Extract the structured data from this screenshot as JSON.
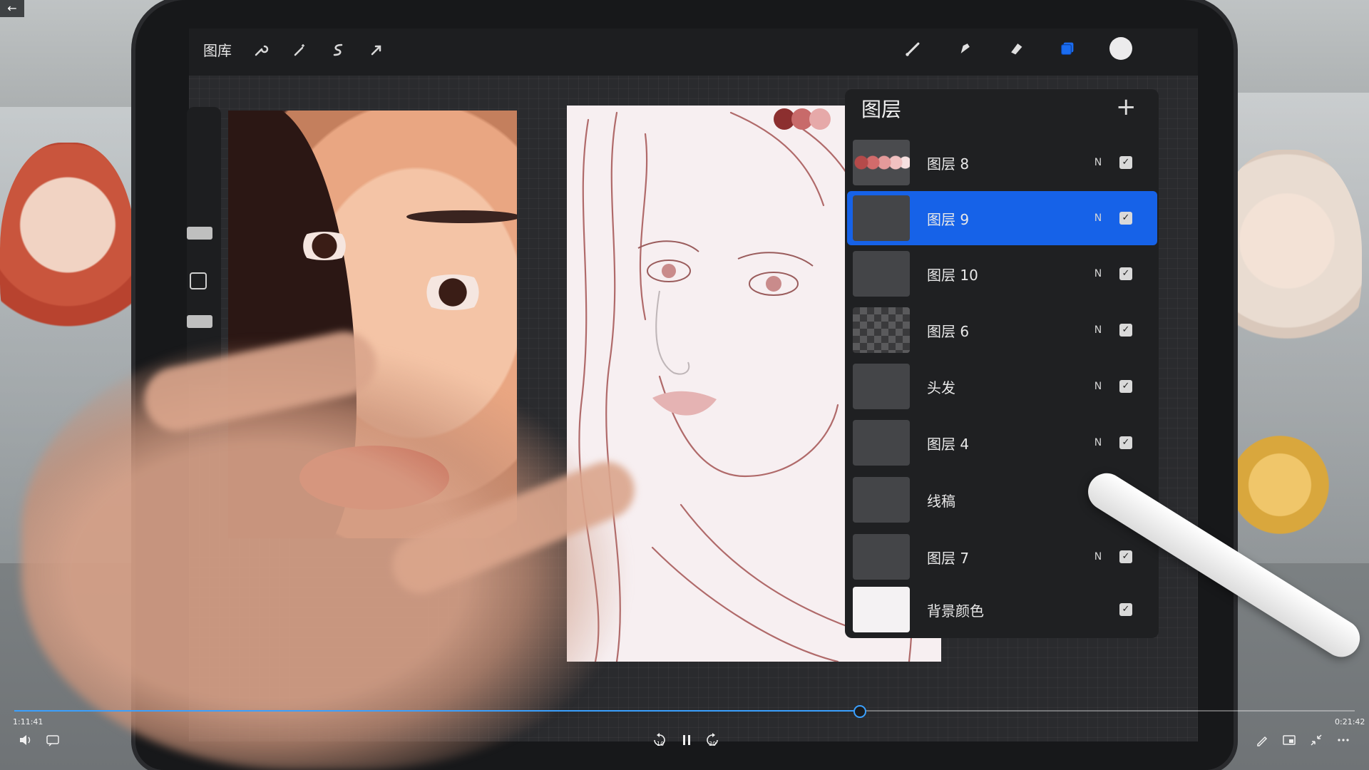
{
  "player": {
    "back_label": "←",
    "elapsed": "1:11:41",
    "remaining": "0:21:42",
    "progress_fraction": 0.63,
    "rewind_label": "10",
    "forward_label": "30"
  },
  "app": {
    "gallery_label": "图库",
    "active_tool_color": "#1a6cf0",
    "current_color": "#ecebec"
  },
  "layers_panel": {
    "title": "图层",
    "add_label": "+",
    "layers": [
      {
        "name": "图层 8",
        "mode": "N",
        "visible": true,
        "selected": false,
        "thumb": "swatches"
      },
      {
        "name": "图层 9",
        "mode": "N",
        "visible": true,
        "selected": true,
        "thumb": "plain"
      },
      {
        "name": "图层 10",
        "mode": "N",
        "visible": true,
        "selected": false,
        "thumb": "plain"
      },
      {
        "name": "图层 6",
        "mode": "N",
        "visible": true,
        "selected": false,
        "thumb": "checker"
      },
      {
        "name": "头发",
        "mode": "N",
        "visible": true,
        "selected": false,
        "thumb": "plain"
      },
      {
        "name": "图层 4",
        "mode": "N",
        "visible": true,
        "selected": false,
        "thumb": "plain"
      },
      {
        "name": "线稿",
        "mode": "N",
        "visible": true,
        "selected": false,
        "thumb": "plain"
      },
      {
        "name": "图层 7",
        "mode": "N",
        "visible": true,
        "selected": false,
        "thumb": "plain"
      },
      {
        "name": "背景颜色",
        "mode": "",
        "visible": true,
        "selected": false,
        "thumb": "white"
      }
    ]
  },
  "palette_colors": [
    "#8c2f2f",
    "#c86a6a",
    "#e6a9a9"
  ]
}
